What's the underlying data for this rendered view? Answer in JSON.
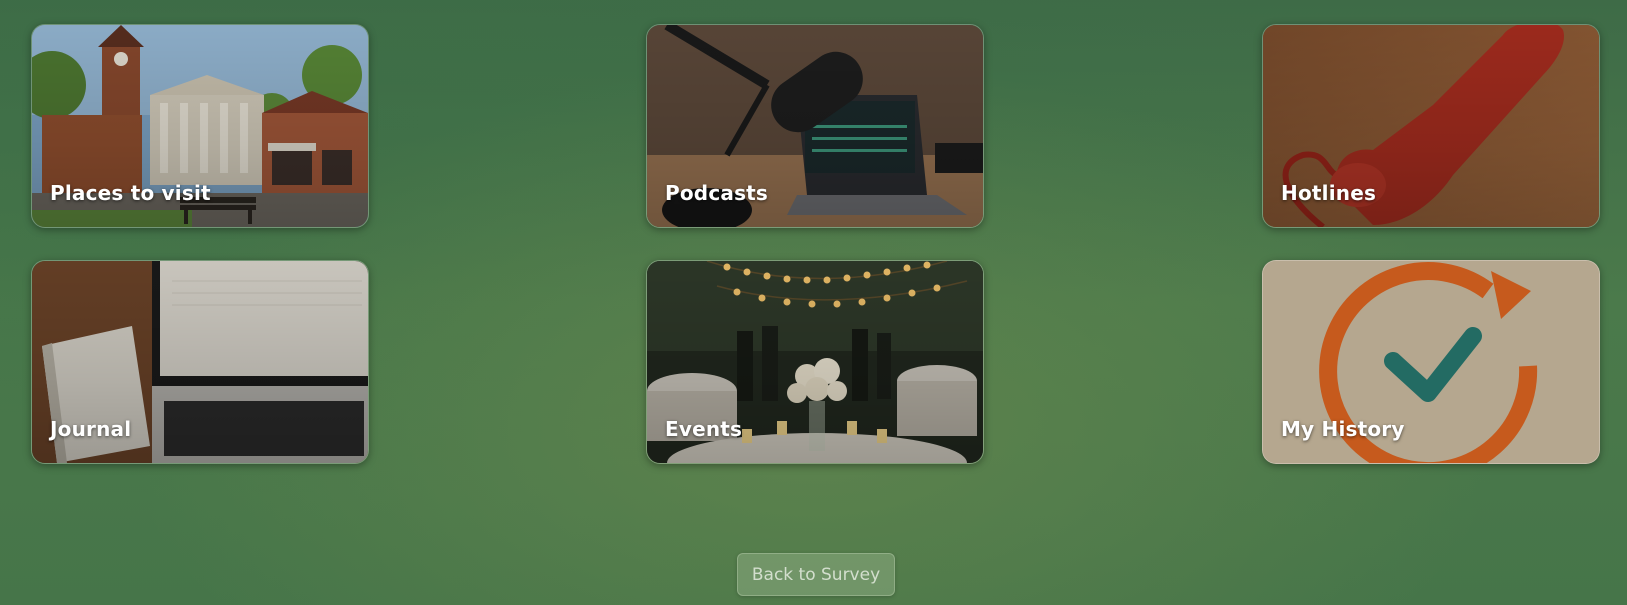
{
  "tiles": [
    {
      "id": "places",
      "label": "Places to visit",
      "image": "town-square-illustration"
    },
    {
      "id": "podcasts",
      "label": "Podcasts",
      "image": "microphone-laptop-illustration"
    },
    {
      "id": "hotlines",
      "label": "Hotlines",
      "image": "red-phone-handset-illustration"
    },
    {
      "id": "journal",
      "label": "Journal",
      "image": "notebook-laptop-illustration"
    },
    {
      "id": "events",
      "label": "Events",
      "image": "party-lights-illustration"
    },
    {
      "id": "history",
      "label": "My History",
      "image": "history-checkmark-icon"
    }
  ],
  "back_button": {
    "label": "Back to Survey"
  },
  "colors": {
    "background": "#467549",
    "history_tile": "#b7a890",
    "history_arrow": "#c85a1c",
    "history_check": "#236b63"
  }
}
